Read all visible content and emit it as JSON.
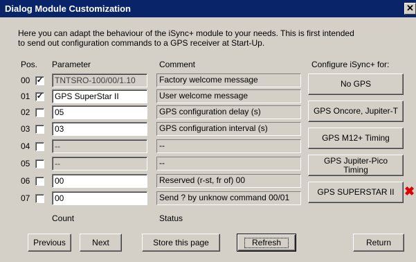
{
  "window": {
    "title": "Dialog Module Customization",
    "close_glyph": "✕"
  },
  "intro": {
    "line1": "Here you can adapt the behaviour of the iSync+ module to your needs. This is first intended",
    "line2": "to send out configuration commands to a GPS receiver at Start-Up."
  },
  "headers": {
    "pos": "Pos.",
    "parameter": "Parameter",
    "comment": "Comment",
    "configure": "Configure iSync+ for:"
  },
  "rows": [
    {
      "pos": "00",
      "checked": true,
      "param": "TNTSRO-100/00/1.10",
      "param_disabled": true,
      "comment": "Factory welcome message"
    },
    {
      "pos": "01",
      "checked": true,
      "param": "GPS SuperStar II",
      "param_disabled": false,
      "comment": "User welcome message"
    },
    {
      "pos": "02",
      "checked": false,
      "param": "05",
      "param_disabled": false,
      "comment": "GPS configuration delay (s)"
    },
    {
      "pos": "03",
      "checked": false,
      "param": "03",
      "param_disabled": false,
      "comment": "GPS configuration interval (s)"
    },
    {
      "pos": "04",
      "checked": false,
      "param": "--",
      "param_disabled": true,
      "comment": "--"
    },
    {
      "pos": "05",
      "checked": false,
      "param": "--",
      "param_disabled": true,
      "comment": "--"
    },
    {
      "pos": "06",
      "checked": false,
      "param": "00",
      "param_disabled": false,
      "comment": "Reserved (r-st, fr of) 00"
    },
    {
      "pos": "07",
      "checked": false,
      "param": "00",
      "param_disabled": false,
      "comment": "Send ? by unknow command 00/01"
    }
  ],
  "configure_buttons": {
    "no_gps": "No GPS",
    "oncore": "GPS Oncore, Jupiter-T",
    "m12": "GPS M12+ Timing",
    "jupiter_pico_l1": "GPS Jupiter-Pico",
    "jupiter_pico_l2": "Timing",
    "superstar": "GPS SUPERSTAR II",
    "selected_marker": "✖"
  },
  "footer": {
    "count": "Count",
    "status": "Status"
  },
  "buttons": {
    "previous": "Previous",
    "next": "Next",
    "store": "Store this page",
    "refresh": "Refresh",
    "return": "Return"
  },
  "colors": {
    "titlebar": "#0a246a",
    "face": "#d4d0c8",
    "marker": "#e00000"
  }
}
